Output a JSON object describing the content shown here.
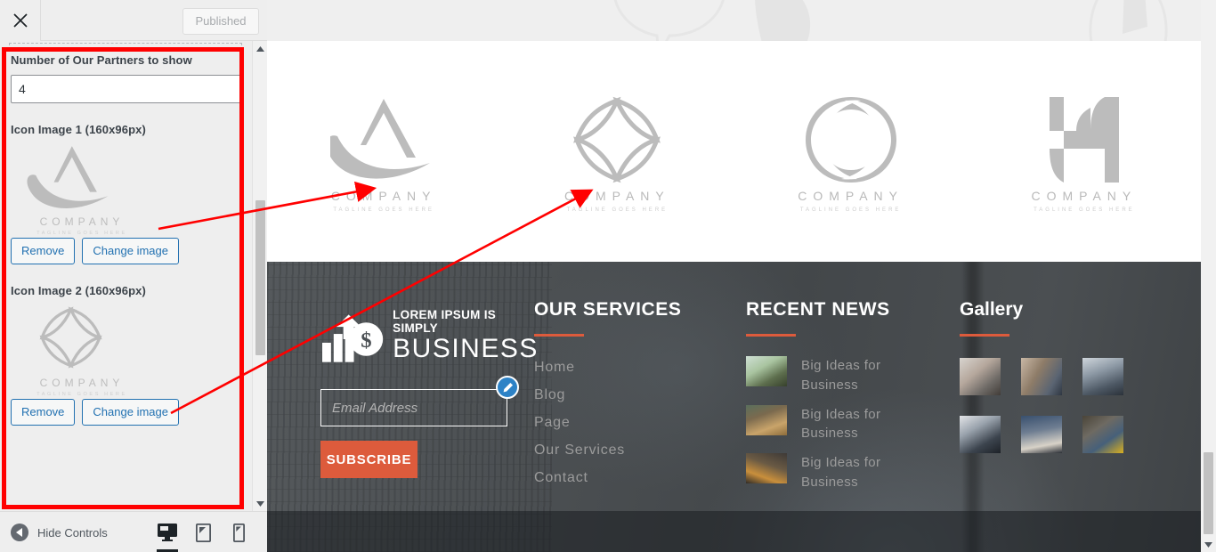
{
  "customizer": {
    "close_icon": "close-icon",
    "publish_label": "Published",
    "number_control": {
      "label": "Number of Our Partners to show",
      "value": "4"
    },
    "image_controls": [
      {
        "label": "Icon Image 1 (160x96px)",
        "preview_name": "COMPANY",
        "preview_tagline": "TAGLINE GOES HERE",
        "remove_label": "Remove",
        "change_label": "Change image"
      },
      {
        "label": "Icon Image 2 (160x96px)",
        "preview_name": "COMPANY",
        "preview_tagline": "TAGLINE GOES HERE",
        "remove_label": "Remove",
        "change_label": "Change image"
      }
    ],
    "footer": {
      "hide_controls_label": "Hide Controls",
      "devices": [
        {
          "name": "desktop",
          "active": true
        },
        {
          "name": "tablet",
          "active": false
        },
        {
          "name": "mobile",
          "active": false
        }
      ]
    }
  },
  "preview": {
    "partners": [
      {
        "name": "COMPANY",
        "tagline": "TAGLINE GOES HERE",
        "mark": "logo-a-swoosh"
      },
      {
        "name": "COMPANY",
        "tagline": "TAGLINE GOES HERE",
        "mark": "logo-diamond-petals"
      },
      {
        "name": "COMPANY",
        "tagline": "TAGLINE GOES HERE",
        "mark": "logo-o-ring"
      },
      {
        "name": "COMPANY",
        "tagline": "TAGLINE GOES HERE",
        "mark": "logo-h-block"
      }
    ],
    "footer": {
      "brand": {
        "top_line": "LOREM IPSUM IS SIMPLY",
        "main_line": "BUSINESS",
        "logo_icon": "bar-chart-dollar-icon"
      },
      "email_placeholder": "Email Address",
      "email_value": "",
      "subscribe_label": "SUBSCRIBE",
      "services": {
        "heading": "OUR SERVICES",
        "items": [
          "Home",
          "Blog",
          "Page",
          "Our Services",
          "Contact"
        ]
      },
      "recent_news": {
        "heading": "RECENT NEWS",
        "items": [
          {
            "title": "Big Ideas for Business"
          },
          {
            "title": "Big Ideas for Business"
          },
          {
            "title": "Big Ideas for Business"
          }
        ]
      },
      "gallery": {
        "heading": "Gallery",
        "thumbs": [
          "gallery-thumb-1",
          "gallery-thumb-2",
          "gallery-thumb-3",
          "gallery-thumb-4",
          "gallery-thumb-5",
          "gallery-thumb-6"
        ]
      },
      "edit_shortcut_icon": "pencil-edit-icon"
    }
  },
  "colors": {
    "accent_orange": "#dd5b3c",
    "footer_bg": "#4a4f53",
    "link_blue": "#2271b1",
    "annotation_red": "#ff0000",
    "edit_pin_blue": "#2d82c6"
  }
}
